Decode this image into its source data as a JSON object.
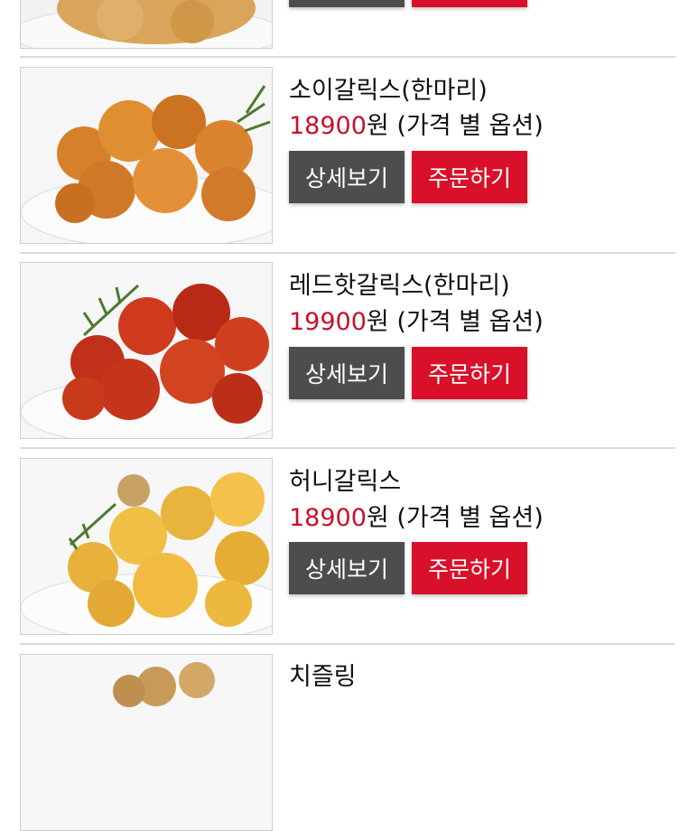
{
  "colors": {
    "price": "#c8102e",
    "detail_button": "#4d4d4d",
    "order_button": "#d8102a",
    "divider": "#d9d9d9"
  },
  "buttons": {
    "detail": "상세보기",
    "order": "주문하기"
  },
  "items": [
    {
      "name": "",
      "price_amount": "",
      "price_suffix": "",
      "image_icon": "fried-chicken-plate"
    },
    {
      "name": "소이갈릭스(한마리)",
      "price_amount": "18900",
      "price_suffix": "원 (가격 별 옵션)",
      "image_icon": "soy-garlic-chicken-plate"
    },
    {
      "name": "레드핫갈릭스(한마리)",
      "price_amount": "19900",
      "price_suffix": "원 (가격 별 옵션)",
      "image_icon": "red-hot-garlic-chicken-plate"
    },
    {
      "name": "허니갈릭스",
      "price_amount": "18900",
      "price_suffix": "원 (가격 별 옵션)",
      "image_icon": "honey-garlic-chicken-plate"
    },
    {
      "name": "치즐링",
      "price_amount": "",
      "price_suffix": "",
      "image_icon": "chicken-plate"
    }
  ]
}
